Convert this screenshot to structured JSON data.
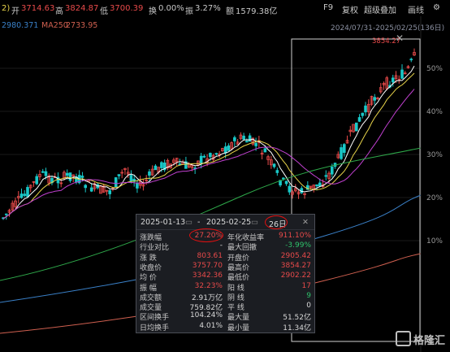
{
  "header": {
    "left_fragment": "2)",
    "open_label": "开",
    "open_value": "3714.63",
    "high_label": "高",
    "high_value": "3824.87",
    "low_label": "低",
    "low_value": "3700.39",
    "turnover_label": "换",
    "turnover_value": "0.00%",
    "amplitude_label": "振",
    "amplitude_value": "3.27%",
    "amount_label": "额",
    "amount_value": "1579.38亿"
  },
  "toolbar": {
    "f9": "F9",
    "adjust": "复权",
    "overlay": "超级叠加",
    "draw": "画线",
    "settings_icon": "gear-icon"
  },
  "ma_line": {
    "ma_value": "2980.371",
    "ma250_label": "MA250",
    "ma250_value": "2733.95"
  },
  "range_label": "2024/07/31-2025/02/25(136日)",
  "y_axis": [
    "50%",
    "40%",
    "30%",
    "20%",
    "10%"
  ],
  "peak_marker": "3854.27",
  "colors": {
    "up": "#e84a4a",
    "down": "#19c8c8",
    "ma5": "#ffffff",
    "ma10": "#e8d44a",
    "ma20": "#c040d0",
    "ma60": "#2ea84a",
    "ma120": "#3a80c8",
    "ma250": "#d06050"
  },
  "panel": {
    "start_date": "2025-01-13",
    "sep": "-",
    "end_date": "2025-02-25",
    "days": "26日",
    "rows": [
      {
        "k1": "涨跌幅",
        "v1": "27.20%",
        "k2": "年化收益率",
        "v2": "911.10%"
      },
      {
        "k1": "行业对比",
        "v1": "-",
        "k2": "最大回撤",
        "v2": "-3.99%"
      },
      {
        "k1": "涨  跌",
        "v1": "803.61",
        "k2": "开盘价",
        "v2": "2905.42"
      },
      {
        "k1": "收盘价",
        "v1": "3757.70",
        "k2": "最高价",
        "v2": "3854.27"
      },
      {
        "k1": "均  价",
        "v1": "3342.36",
        "k2": "最低价",
        "v2": "2902.22"
      },
      {
        "k1": "振  幅",
        "v1": "32.23%",
        "k2": "阳  线",
        "v2": "17"
      },
      {
        "k1": "成交额",
        "v1": "2.91万亿",
        "k2": "阴  线",
        "v2": "9"
      },
      {
        "k1": "成交量",
        "v1": "759.82亿",
        "k2": "平  线",
        "v2": "0"
      },
      {
        "k1": "区间换手",
        "v1": "104.24%",
        "k2": "最大量",
        "v2": "51.52亿"
      },
      {
        "k1": "日均换手",
        "v1": "4.01%",
        "k2": "最小量",
        "v2": "11.34亿"
      }
    ]
  },
  "logo": "格隆汇"
}
